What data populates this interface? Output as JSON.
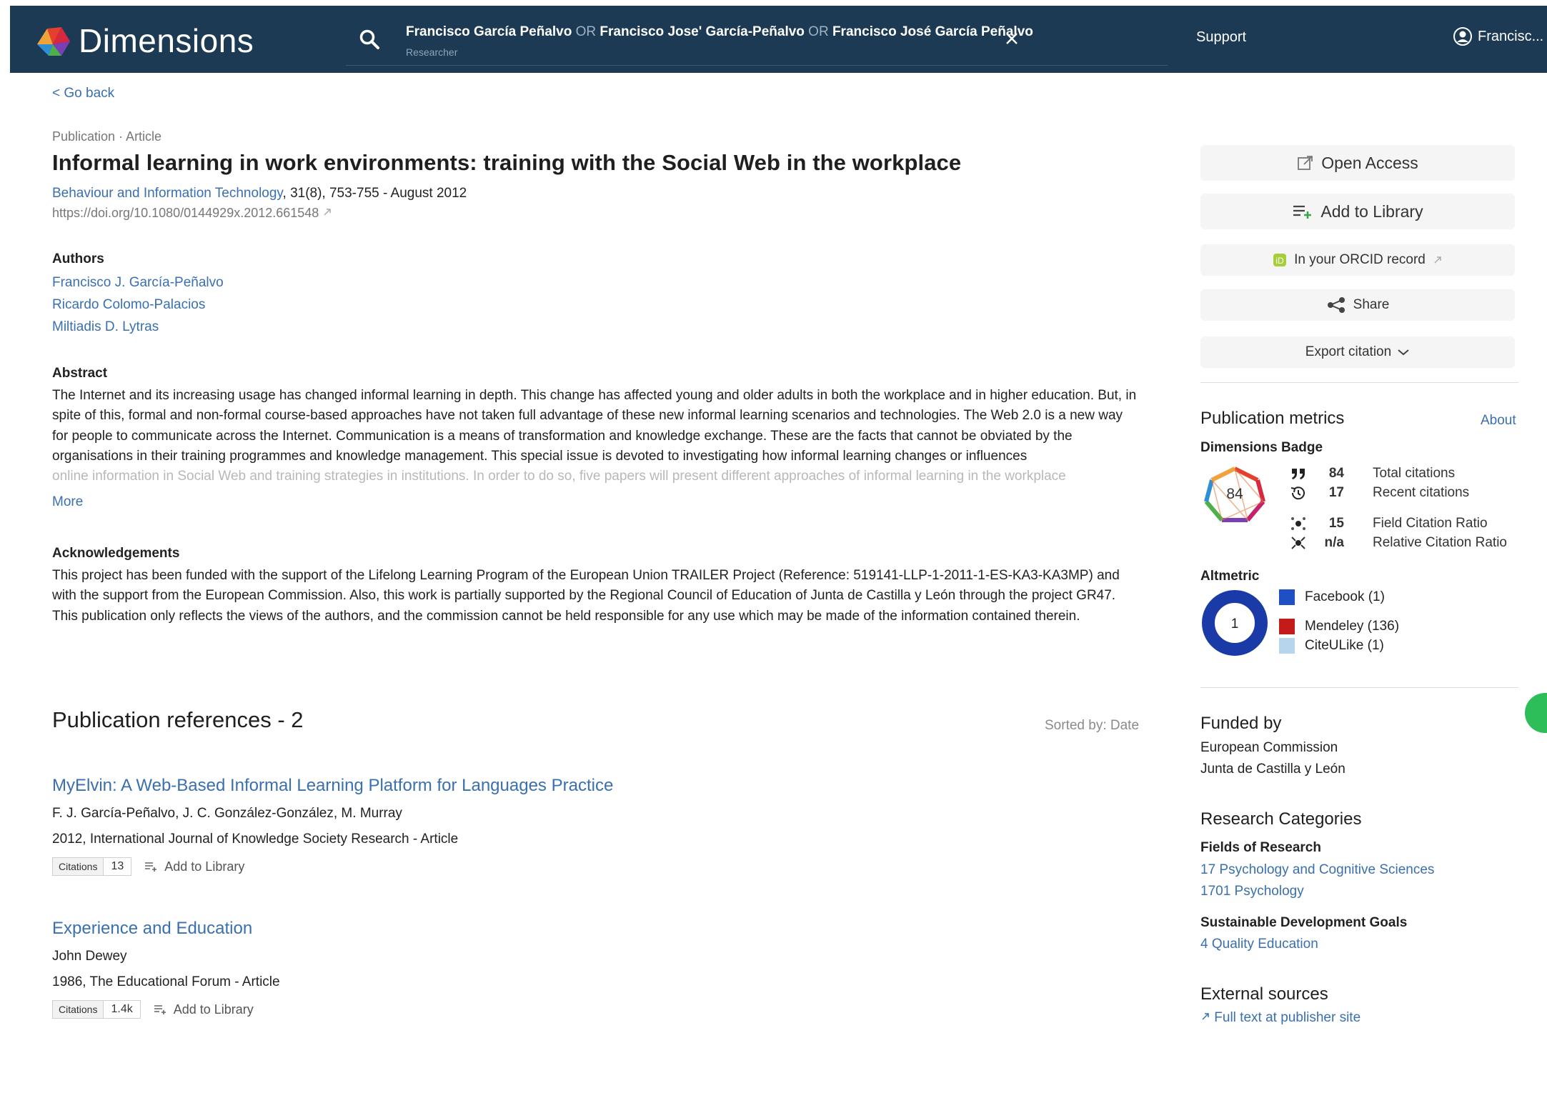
{
  "header": {
    "app_name": "Dimensions",
    "search": {
      "term1": "Francisco García Peñalvo",
      "op1": "OR",
      "term2": "Francisco Jose' García-Peñalvo",
      "op2": "OR",
      "term3": "Francisco José García Peñalvo",
      "subtitle": "Researcher"
    },
    "support": "Support",
    "user": "Francisc..."
  },
  "nav": {
    "back": "< Go back"
  },
  "publication": {
    "crumb": "Publication · Article",
    "title": "Informal learning in work environments: training with the Social Web in the workplace",
    "journal": "Behaviour and Information Technology",
    "journal_details": ", 31(8), 753-755 - August 2012",
    "doi": "https://doi.org/10.1080/0144929x.2012.661548"
  },
  "authors": {
    "heading": "Authors",
    "list": [
      "Francisco J. García-Peñalvo",
      "Ricardo Colomo-Palacios",
      "Miltiadis D. Lytras"
    ]
  },
  "abstract": {
    "heading": "Abstract",
    "text": "The Internet and its increasing usage has changed informal learning in depth. This change has affected young and older adults in both the workplace and in higher education. But, in spite of this, formal and non-formal course-based approaches have not taken full advantage of these new informal learning scenarios and technologies. The Web 2.0 is a new way for people to communicate across the Internet. Communication is a means of transformation and knowledge exchange. These are the facts that cannot be obviated by the organisations in their training programmes and knowledge management. This special issue is devoted to investigating how informal learning changes or influences",
    "faded": "online information in Social Web and training strategies in institutions. In order to do so, five papers will present different approaches of informal learning in the workplace",
    "more": "More"
  },
  "acknowledgements": {
    "heading": "Acknowledgements",
    "text": "This project has been funded with the support of the Lifelong Learning Program of the European Union TRAILER Project (Reference: 519141-LLP-1-2011-1-ES-KA3-KA3MP) and with the support from the European Commission. Also, this work is partially supported by the Regional Council of Education of Junta de Castilla y León through the project GR47. This publication only reflects the views of the authors, and the commission cannot be held responsible for any use which may be made of the information contained therein."
  },
  "references": {
    "heading": "Publication references - 2",
    "sorted_by": "Sorted by: Date",
    "items": [
      {
        "title": "MyElvin: A Web-Based Informal Learning Platform for Languages Practice",
        "authors": "F. J. García-Peñalvo, J. C. González-González, M. Murray",
        "meta": "2012, International Journal of Knowledge Society Research - Article",
        "citations_label": "Citations",
        "citations": "13",
        "add_label": "Add to Library"
      },
      {
        "title": "Experience and Education",
        "authors": "John Dewey",
        "meta": "1986, The Educational Forum - Article",
        "citations_label": "Citations",
        "citations": "1.4k",
        "add_label": "Add to Library"
      }
    ]
  },
  "actions": {
    "open_access": "Open Access",
    "add_library": "Add to Library",
    "orcid": "In your ORCID record",
    "share": "Share",
    "export": "Export citation"
  },
  "metrics": {
    "heading": "Publication metrics",
    "about": "About",
    "badge_heading": "Dimensions Badge",
    "badge_value": "84",
    "rows": [
      {
        "value": "84",
        "label": "Total citations"
      },
      {
        "value": "17",
        "label": "Recent citations"
      },
      {
        "value": "15",
        "label": "Field Citation Ratio"
      },
      {
        "value": "n/a",
        "label": "Relative Citation Ratio"
      }
    ],
    "altmetric_heading": "Altmetric",
    "altmetric_score": "1",
    "altmetric_sources": [
      {
        "label": "Facebook (1)",
        "color": "#1f4fc2"
      },
      {
        "label": "Mendeley (136)",
        "color": "#c41a1a"
      },
      {
        "label": "CiteULike (1)",
        "color": "#b7d6ee"
      }
    ]
  },
  "funded": {
    "heading": "Funded by",
    "items": [
      "European Commission",
      "Junta de Castilla y León"
    ]
  },
  "categories": {
    "heading": "Research Categories",
    "for_heading": "Fields of Research",
    "for_items": [
      "17 Psychology and Cognitive Sciences",
      "1701 Psychology"
    ],
    "sdg_heading": "Sustainable Development Goals",
    "sdg_items": [
      "4 Quality Education"
    ]
  },
  "external": {
    "heading": "External sources",
    "link": "Full text at publisher site"
  },
  "colors": {
    "topbar": "#1d3a55",
    "link": "#3a6fb0",
    "altmetric_ring": "#1a3aa8"
  }
}
